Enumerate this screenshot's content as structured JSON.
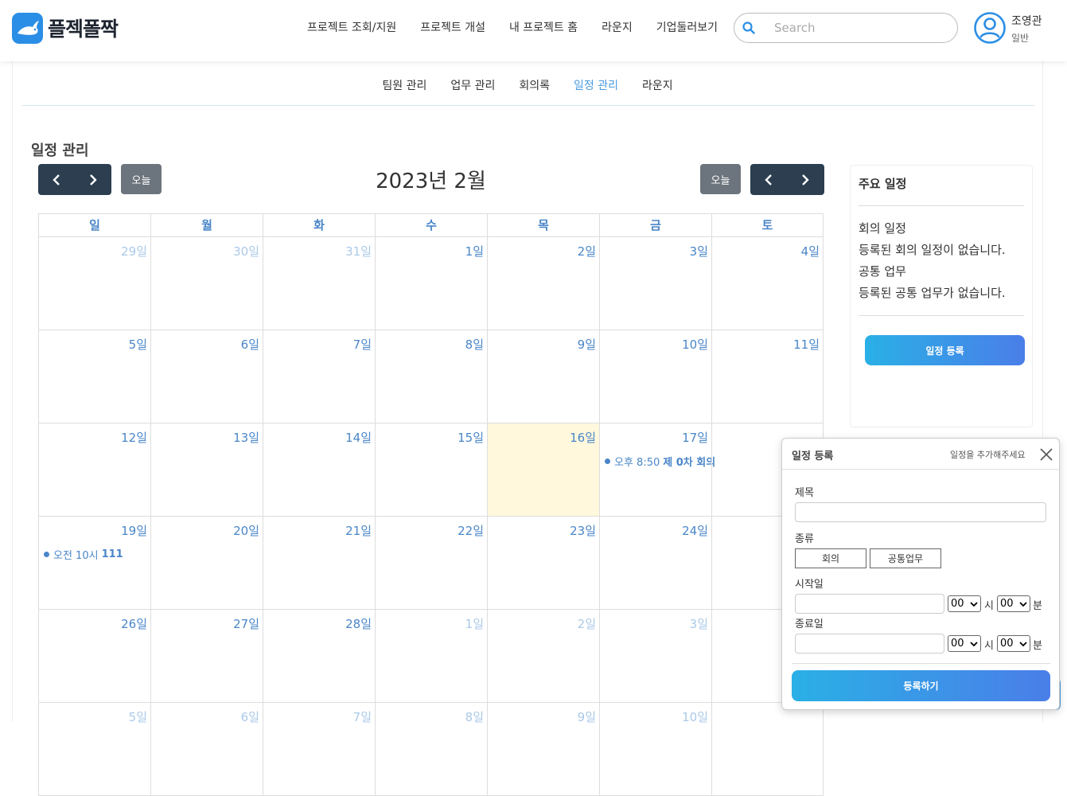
{
  "header": {
    "logo_text": "플젝폴짝",
    "nav": [
      "프로젝트 조회/지원",
      "프로젝트 개설",
      "내 프로젝트 홈",
      "라운지",
      "기업둘러보기"
    ],
    "search_placeholder": "Search",
    "user_name": "조영관",
    "user_role": "일반"
  },
  "subnav": {
    "items": [
      "팀원 관리",
      "업무 관리",
      "회의록",
      "일정 관리",
      "라운지"
    ],
    "active": "일정 관리"
  },
  "page_title": "일정 관리",
  "calendar": {
    "title": "2023년 2월",
    "today_label": "오늘",
    "weekdays": [
      "일",
      "월",
      "화",
      "수",
      "목",
      "금",
      "토"
    ],
    "weeks": [
      [
        "29일",
        "30일",
        "31일",
        "1일",
        "2일",
        "3일",
        "4일"
      ],
      [
        "5일",
        "6일",
        "7일",
        "8일",
        "9일",
        "10일",
        "11일"
      ],
      [
        "12일",
        "13일",
        "14일",
        "15일",
        "16일",
        "17일",
        ""
      ],
      [
        "19일",
        "20일",
        "21일",
        "22일",
        "23일",
        "24일",
        ""
      ],
      [
        "26일",
        "27일",
        "28일",
        "1일",
        "2일",
        "3일",
        ""
      ],
      [
        "5일",
        "6일",
        "7일",
        "8일",
        "9일",
        "10일",
        ""
      ]
    ],
    "events": [
      {
        "time": "오후 8:50",
        "title": "제 0차 회의"
      },
      {
        "time": "오전 10시",
        "title": "111"
      }
    ],
    "event_color": "#4a86c8",
    "today_color": "#fff8dc"
  },
  "side": {
    "title": "주요 일정",
    "meeting_heading": "회의 일정",
    "meeting_empty": "등록된 회의 일정이 없습니다.",
    "task_heading": "공통 업무",
    "task_empty": "등록된 공통 업무가 없습니다.",
    "register_button": "일정 등록"
  },
  "modal": {
    "title": "일정 등록",
    "subtitle": "일정을 추가해주세요",
    "title_label": "제목",
    "type_label": "종류",
    "type_options": [
      "회의",
      "공통업무"
    ],
    "start_label": "시작일",
    "end_label": "종료일",
    "hour_value": "00",
    "minute_value": "00",
    "hour_unit": "시",
    "minute_unit": "분",
    "submit": "등록하기"
  }
}
